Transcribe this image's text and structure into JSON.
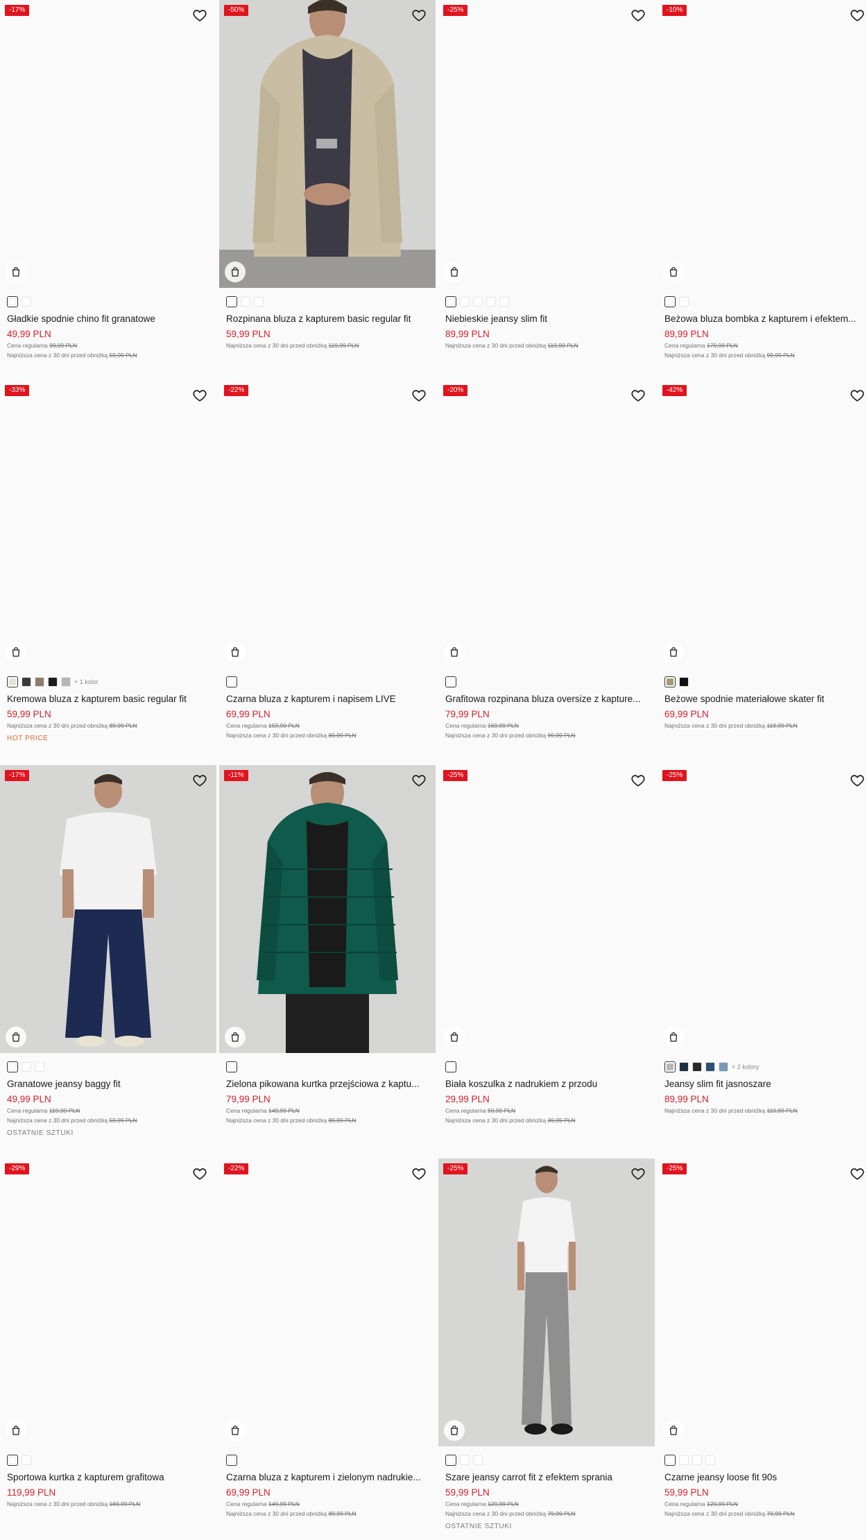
{
  "products": [
    {
      "badge": "-17%",
      "title": "Gładkie spodnie chino fit granatowe",
      "price": "49,99 PLN",
      "regular_label": "Cena regularna",
      "regular": "99,99 PLN",
      "lowest_label": "Najniższa cena z 30 dni przed obniżką",
      "lowest": "59,99 PLN",
      "swatches": [
        "#ffffff",
        "#ffffff"
      ],
      "more": "",
      "tag": ""
    },
    {
      "badge": "-50%",
      "title": "Rozpinana bluza z kapturem basic regular fit",
      "price": "59,99 PLN",
      "regular_label": "",
      "regular": "",
      "lowest_label": "Najniższa cena z 30 dni przed obniżką",
      "lowest": "119,99 PLN",
      "swatches": [
        "#ffffff",
        "#ffffff",
        "#ffffff"
      ],
      "more": "",
      "tag": ""
    },
    {
      "badge": "-25%",
      "title": "Niebieskie jeansy slim fit",
      "price": "89,99 PLN",
      "regular_label": "",
      "regular": "",
      "lowest_label": "Najniższa cena z 30 dni przed obniżką",
      "lowest": "119,99 PLN",
      "swatches": [
        "#ffffff",
        "#ffffff",
        "#ffffff",
        "#ffffff",
        "#ffffff"
      ],
      "more": "",
      "tag": ""
    },
    {
      "badge": "-10%",
      "title": "Beżowa bluza bombka z kapturem i efektem...",
      "price": "89,99 PLN",
      "regular_label": "Cena regularna",
      "regular": "179,99 PLN",
      "lowest_label": "Najniższa cena z 30 dni przed obniżką",
      "lowest": "99,99 PLN",
      "swatches": [
        "#ffffff",
        "#ffffff"
      ],
      "more": "",
      "tag": ""
    },
    {
      "badge": "-33%",
      "title": "Kremowa bluza z kapturem basic regular fit",
      "price": "59,99 PLN",
      "regular_label": "",
      "regular": "",
      "lowest_label": "Najniższa cena z 30 dni przed obniżką",
      "lowest": "89,99 PLN",
      "swatches": [
        "#e6e1d4",
        "#3a3a3a",
        "#8b7d6a",
        "#1b1b1b",
        "#b5b5b5"
      ],
      "more": "+ 1 kolor",
      "tag": "HOT PRICE",
      "tag_type": "hot"
    },
    {
      "badge": "-22%",
      "title": "Czarna bluza z kapturem i napisem LIVE",
      "price": "69,99 PLN",
      "regular_label": "Cena regularna",
      "regular": "159,99 PLN",
      "lowest_label": "Najniższa cena z 30 dni przed obniżką",
      "lowest": "89,99 PLN",
      "swatches": [
        "#ffffff"
      ],
      "more": "",
      "tag": ""
    },
    {
      "badge": "-20%",
      "title": "Grafitowa rozpinana bluza oversize z kapture...",
      "price": "79,99 PLN",
      "regular_label": "Cena regularna",
      "regular": "169,99 PLN",
      "lowest_label": "Najniższa cena z 30 dni przed obniżką",
      "lowest": "99,99 PLN",
      "swatches": [
        "#ffffff"
      ],
      "more": "",
      "tag": ""
    },
    {
      "badge": "-42%",
      "title": "Beżowe spodnie materiałowe skater fit",
      "price": "69,99 PLN",
      "regular_label": "",
      "regular": "",
      "lowest_label": "Najniższa cena z 30 dni przed obniżką",
      "lowest": "119,99 PLN",
      "swatches": [
        "#a89a77",
        "#111111"
      ],
      "more": "",
      "tag": ""
    },
    {
      "badge": "-17%",
      "title": "Granatowe jeansy baggy fit",
      "price": "49,99 PLN",
      "regular_label": "Cena regularna",
      "regular": "119,99 PLN",
      "lowest_label": "Najniższa cena z 30 dni przed obniżką",
      "lowest": "59,99 PLN",
      "swatches": [
        "#ffffff",
        "#ffffff",
        "#ffffff"
      ],
      "more": "",
      "tag": "OSTATNIE SZTUKI",
      "tag_type": "last"
    },
    {
      "badge": "-11%",
      "title": "Zielona pikowana kurtka przejściowa z kaptu...",
      "price": "79,99 PLN",
      "regular_label": "Cena regularna",
      "regular": "149,99 PLN",
      "lowest_label": "Najniższa cena z 30 dni przed obniżką",
      "lowest": "89,99 PLN",
      "swatches": [
        "#ffffff"
      ],
      "more": "",
      "tag": ""
    },
    {
      "badge": "-25%",
      "title": "Biała koszulka z nadrukiem z przodu",
      "price": "29,99 PLN",
      "regular_label": "Cena regularna",
      "regular": "59,99 PLN",
      "lowest_label": "Najniższa cena z 30 dni przed obniżką",
      "lowest": "39,99 PLN",
      "swatches": [
        "#ffffff"
      ],
      "more": "",
      "tag": ""
    },
    {
      "badge": "-25%",
      "title": "Jeansy slim fit jasnoszare",
      "price": "89,99 PLN",
      "regular_label": "",
      "regular": "",
      "lowest_label": "Najniższa cena z 30 dni przed obniżką",
      "lowest": "119,99 PLN",
      "swatches": [
        "#b8b8b8",
        "#1f2d45",
        "#2a2a2a",
        "#2f4f75",
        "#7b99b5"
      ],
      "more": "+ 2 kolory",
      "tag": ""
    },
    {
      "badge": "-29%",
      "title": "Sportowa kurtka z kapturem grafitowa",
      "price": "119,99 PLN",
      "regular_label": "",
      "regular": "",
      "lowest_label": "Najniższa cena z 30 dni przed obniżką",
      "lowest": "169,99 PLN",
      "swatches": [
        "#ffffff",
        "#ffffff"
      ],
      "more": "",
      "tag": ""
    },
    {
      "badge": "-22%",
      "title": "Czarna bluza z kapturem i zielonym nadrukie...",
      "price": "69,99 PLN",
      "regular_label": "Cena regularna",
      "regular": "149,99 PLN",
      "lowest_label": "Najniższa cena z 30 dni przed obniżką",
      "lowest": "89,99 PLN",
      "swatches": [
        "#ffffff"
      ],
      "more": "",
      "tag": ""
    },
    {
      "badge": "-25%",
      "title": "Szare jeansy carrot fit z efektem sprania",
      "price": "59,99 PLN",
      "regular_label": "Cena regularna",
      "regular": "129,99 PLN",
      "lowest_label": "Najniższa cena z 30 dni przed obniżką",
      "lowest": "79,99 PLN",
      "swatches": [
        "#ffffff",
        "#ffffff",
        "#ffffff"
      ],
      "more": "",
      "tag": "OSTATNIE SZTUKI",
      "tag_type": "last"
    },
    {
      "badge": "-25%",
      "title": "Czarne jeansy loose fit 90s",
      "price": "59,99 PLN",
      "regular_label": "Cena regularna",
      "regular": "129,99 PLN",
      "lowest_label": "Najniższa cena z 30 dni przed obniżką",
      "lowest": "79,99 PLN",
      "swatches": [
        "#ffffff",
        "#ffffff",
        "#ffffff",
        "#ffffff"
      ],
      "more": "",
      "tag": ""
    }
  ],
  "photos": {
    "1": "hoodie-beige",
    "8": "baggy-jeans",
    "9": "green-puffer",
    "14": "grey-carrot-jeans"
  },
  "icons": {
    "wishlist": "heart-icon",
    "add_to_cart": "shopping-bag-icon"
  },
  "colors": {
    "badge": "#e0141e",
    "price": "#d2212b",
    "hot_price": "#d86a2b"
  }
}
